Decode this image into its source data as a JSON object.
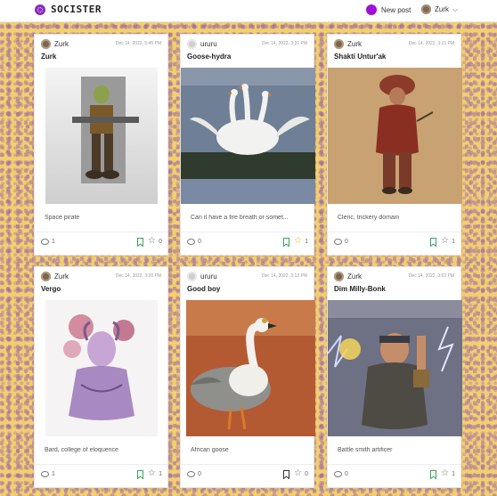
{
  "header": {
    "logo_text": "SOCISTER",
    "new_post_label": "New post",
    "user_name": "Zurk"
  },
  "colors": {
    "accent": "#a10fd6",
    "bookmark_green": "#3aa35b",
    "star_gold": "#e0b400"
  },
  "cards": [
    {
      "author": "Zurk",
      "date": "Dec 14, 2022, 5:45 PM",
      "title": "Zurk",
      "description": "Space pirate",
      "comments": "1",
      "likes": "0",
      "bookmarked": true,
      "starred": false
    },
    {
      "author": "ururu",
      "date": "Dec 14, 2022, 3:31 PM",
      "title": "Goose-hydra",
      "description": "Can it have a fire breath or somet...",
      "comments": "0",
      "likes": "1",
      "bookmarked": true,
      "starred": true
    },
    {
      "author": "Zurk",
      "date": "Dec 14, 2022, 3:21 PM",
      "title": "Shakti Untur'ak",
      "description": "Cleric, trickery domain",
      "comments": "0",
      "likes": "1",
      "bookmarked": true,
      "starred": false
    },
    {
      "author": "Zurk",
      "date": "Dec 14, 2022, 3:20 PM",
      "title": "Vergo",
      "description": "Bard, college of eloquence",
      "comments": "1",
      "likes": "1",
      "bookmarked": true,
      "starred": false
    },
    {
      "author": "ururu",
      "date": "Dec 14, 2022, 3:12 PM",
      "title": "Good boy",
      "description": "African goose",
      "comments": "0",
      "likes": "0",
      "bookmarked": false,
      "starred": false
    },
    {
      "author": "Zurk",
      "date": "Dec 14, 2022, 3:02 PM",
      "title": "Dim Milly-Bonk",
      "description": "Battle smith artificer",
      "comments": "0",
      "likes": "1",
      "bookmarked": true,
      "starred": false
    }
  ]
}
